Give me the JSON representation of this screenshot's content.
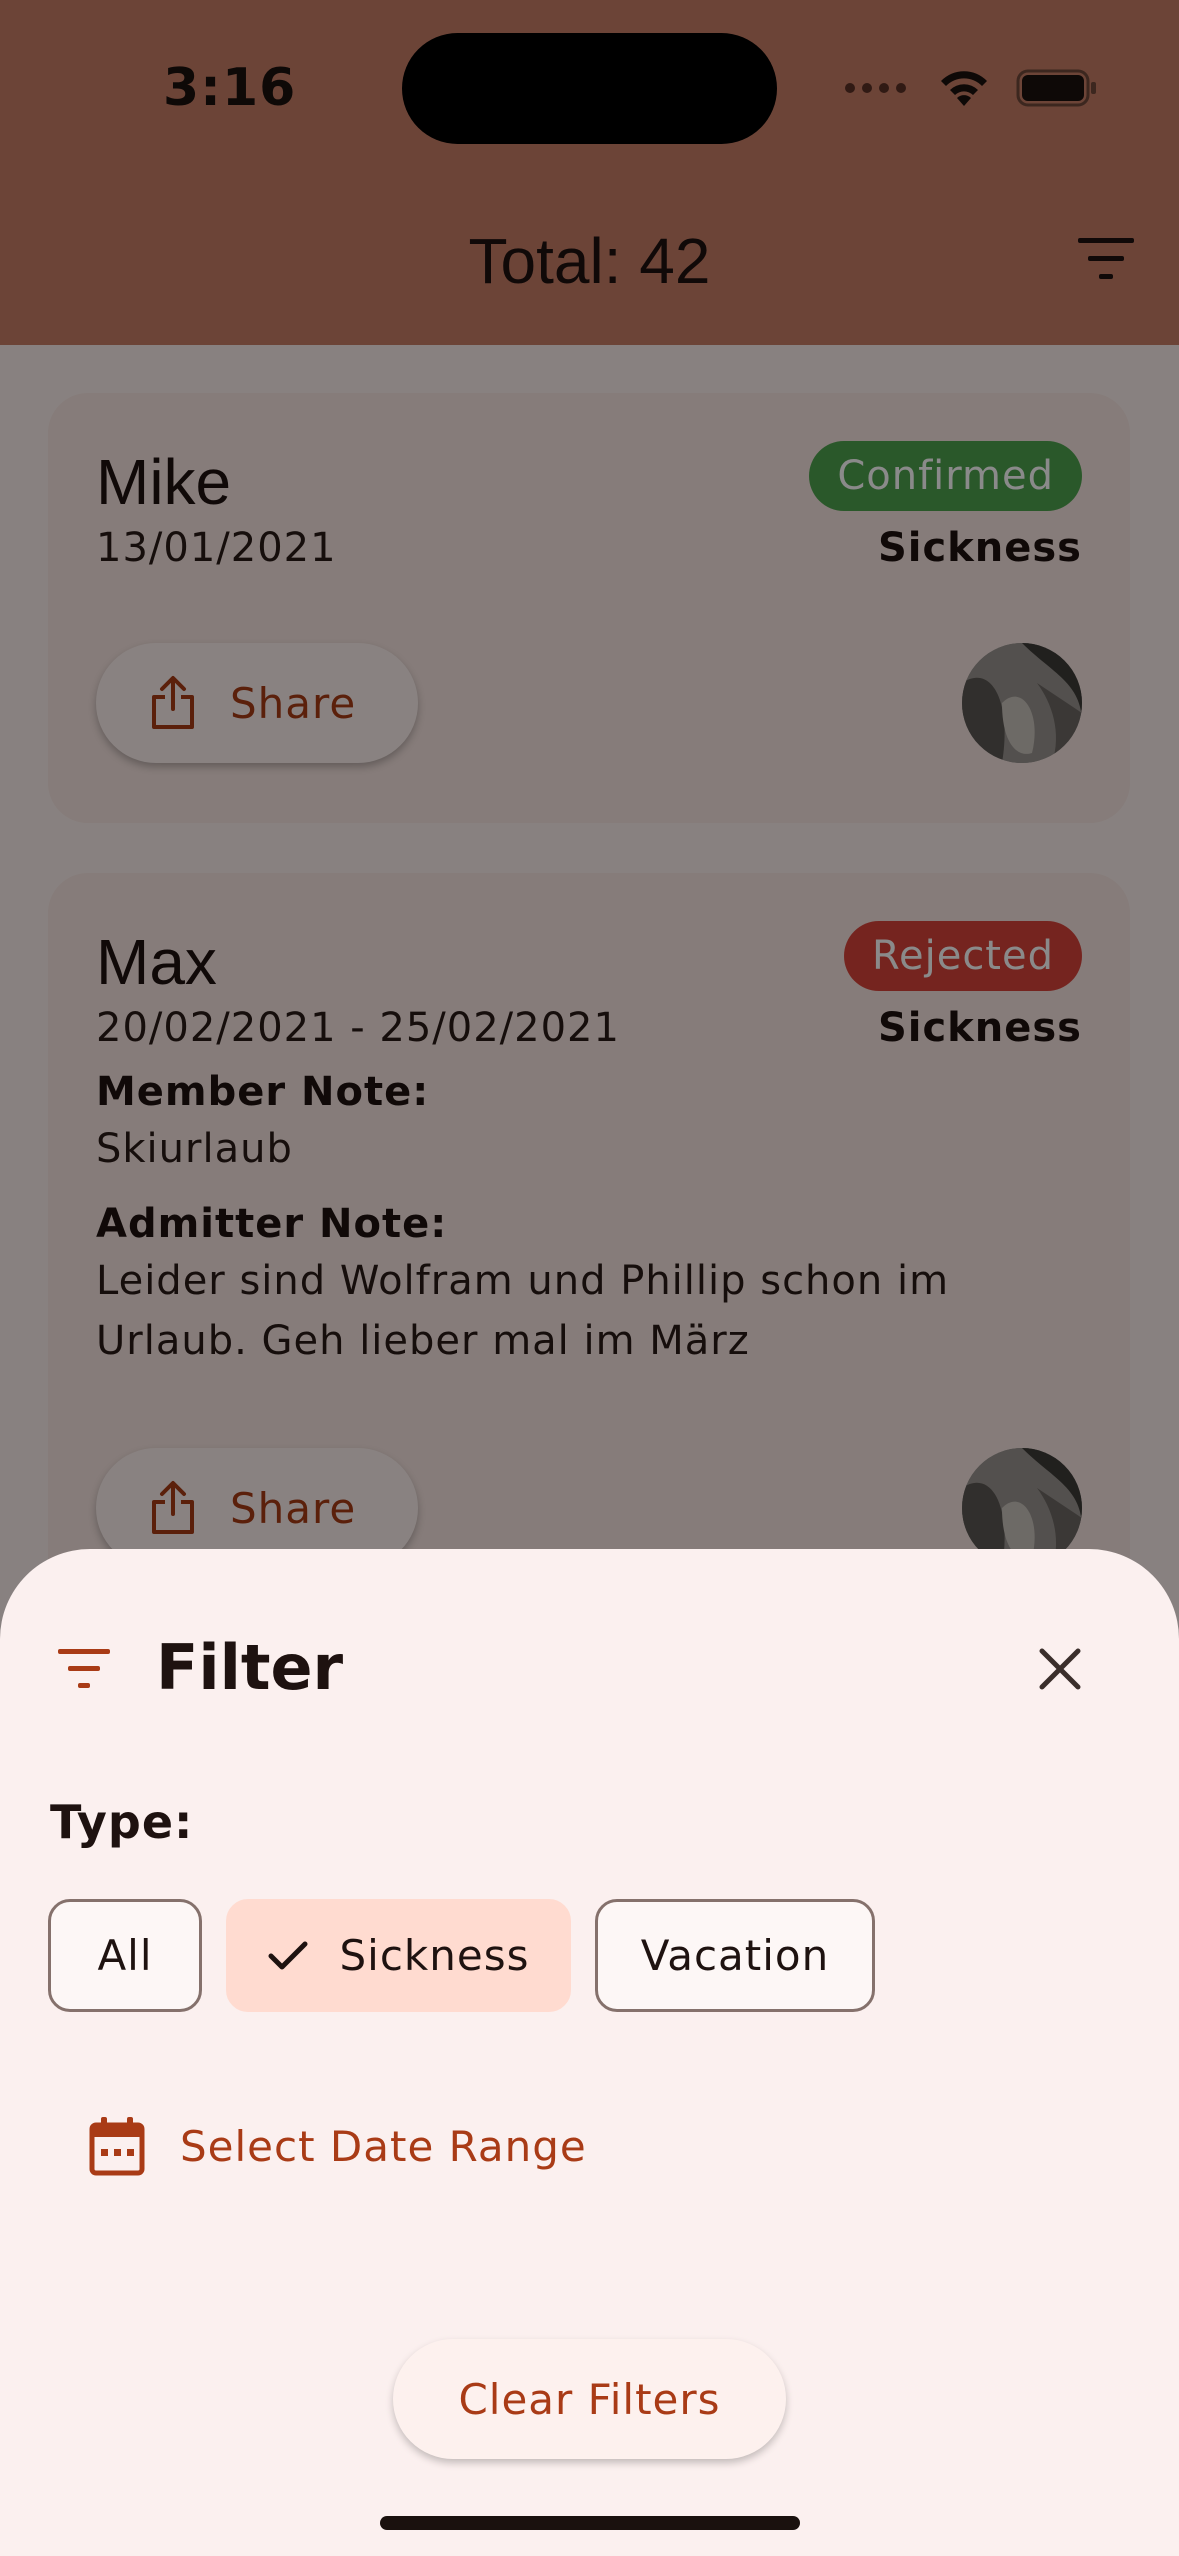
{
  "status_bar": {
    "time": "3:16"
  },
  "header": {
    "title": "Total: 42",
    "filter_icon": "filter-icon"
  },
  "cards": [
    {
      "name": "Mike",
      "date": "13/01/2021",
      "status": "Confirmed",
      "type": "Sickness",
      "share_label": "Share"
    },
    {
      "name": "Max",
      "date": "20/02/2021 - 25/02/2021",
      "status": "Rejected",
      "type": "Sickness",
      "member_note_label": "Member Note:",
      "member_note": "Skiurlaub",
      "admitter_note_label": "Admitter Note:",
      "admitter_note": "Leider sind Wolfram und Phillip schon im Urlaub. Geh lieber mal im März",
      "share_label": "Share"
    }
  ],
  "filter_sheet": {
    "title": "Filter",
    "type_label": "Type:",
    "chips": [
      {
        "label": "All",
        "selected": false
      },
      {
        "label": "Sickness",
        "selected": true
      },
      {
        "label": "Vacation",
        "selected": false
      }
    ],
    "date_range_label": "Select Date Range",
    "clear_label": "Clear Filters"
  },
  "colors": {
    "primary": "#a93b16",
    "app_bar": "#c77e66",
    "confirmed": "#4fa34e",
    "rejected": "#d9443a",
    "selected_chip": "#ffdbd0"
  }
}
